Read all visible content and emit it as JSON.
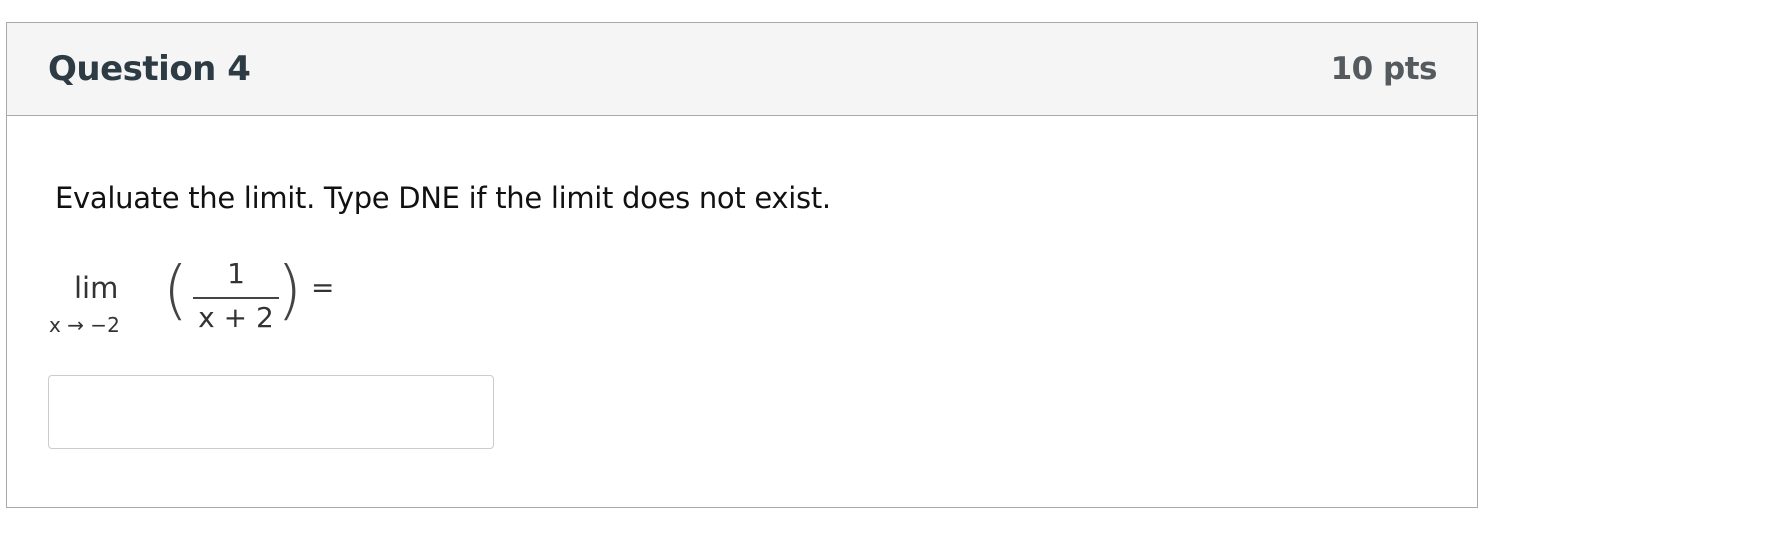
{
  "question": {
    "title": "Question 4",
    "points": "10 pts",
    "prompt": "Evaluate the limit. Type DNE if the limit does not exist.",
    "expression": {
      "operator": "lim",
      "subscript": "x → −2",
      "numerator": "1",
      "denominator": "x + 2",
      "equals": "="
    },
    "answer": {
      "value": "",
      "placeholder": ""
    }
  }
}
